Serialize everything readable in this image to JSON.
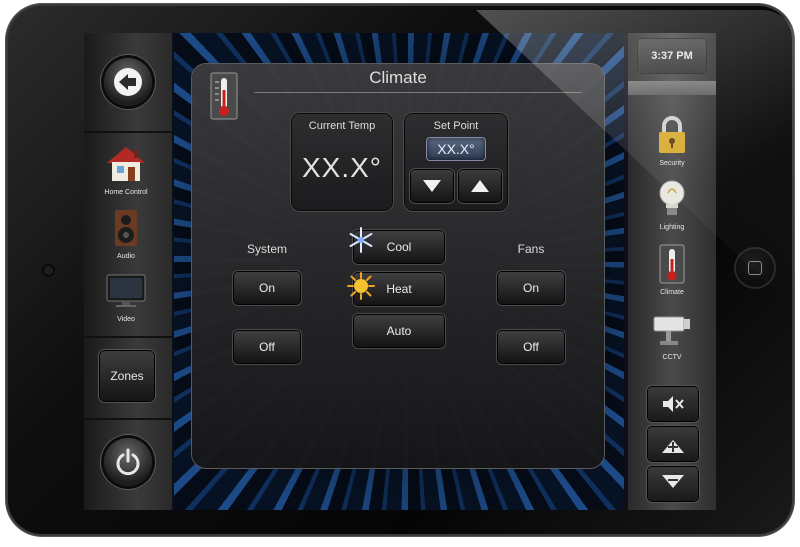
{
  "clock": "3:37 PM",
  "climate_title": "Climate",
  "current_temp": {
    "label": "Current Temp",
    "value": "XX.X°"
  },
  "set_point": {
    "label": "Set Point",
    "value": "XX.X°"
  },
  "system": {
    "label": "System",
    "on": "On",
    "off": "Off"
  },
  "fans": {
    "label": "Fans",
    "on": "On",
    "off": "Off"
  },
  "modes": {
    "cool": "Cool",
    "heat": "Heat",
    "auto": "Auto"
  },
  "left_nav": {
    "home_control": "Home Control",
    "audio": "Audio",
    "video": "Video",
    "zones": "Zones"
  },
  "right_nav": {
    "security": "Security",
    "lighting": "Lighting",
    "climate": "Climate",
    "cctv": "CCTV"
  },
  "icons": {
    "back": "back-arrow-icon",
    "power": "power-icon",
    "mute": "mute-icon",
    "vol_up": "volume-up-icon",
    "vol_down": "volume-down-icon",
    "sp_down": "down-arrow-icon",
    "sp_up": "up-arrow-icon"
  },
  "colors": {
    "accent_blue": "#1c4a86",
    "setpoint_bg": "#3b4a66",
    "text": "#e6e6e6"
  }
}
